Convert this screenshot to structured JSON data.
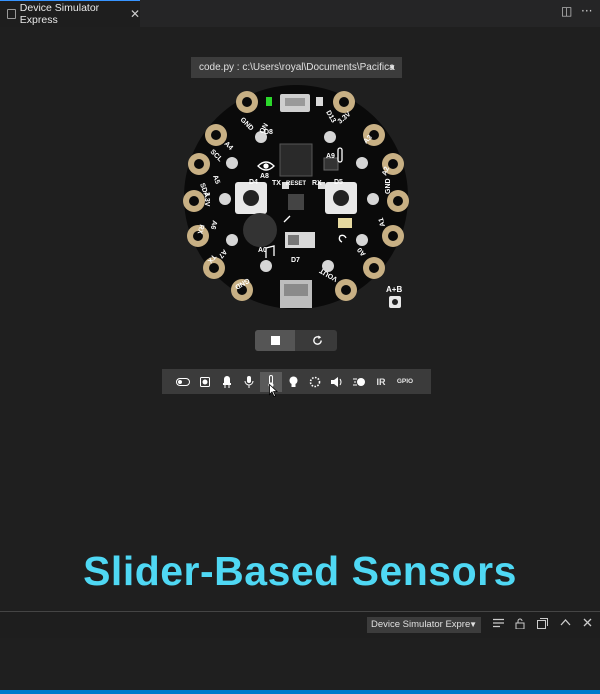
{
  "tab": {
    "title": "Device Simulator Express",
    "close": "✕"
  },
  "editor_actions": {
    "split": "◫",
    "more": "···"
  },
  "file_selector": {
    "value": "code.py : c:\\Users\\royal\\Documents\\Pacifica",
    "arrow": "▼"
  },
  "board": {
    "pins": {
      "gnd": "GND",
      "scl": "SCL",
      "sda": "SDA",
      "a4": "A4",
      "a5": "A5",
      "v33": "3.3V",
      "rx": "RX",
      "a6": "A6",
      "tx": "TX",
      "a7": "A7",
      "a3": "A3",
      "a2": "A2",
      "a1": "A1",
      "a0": "A0",
      "vout": "VOUT",
      "d8": "D8",
      "d4": "D4",
      "d5": "D5",
      "d7": "D7",
      "on": "ON",
      "d13": "D13",
      "a8": "A8",
      "a9": "A9",
      "reset": "RESET",
      "rxl": "RX",
      "txl": "TX",
      "ab": "A+B"
    }
  },
  "sensor_toolbar": {
    "ir": "IR",
    "gpio": "GPIO"
  },
  "caption": "Slider-Based Sensors",
  "output_panel": {
    "selected": "Device Simulator Expre",
    "arrow": "▼"
  }
}
